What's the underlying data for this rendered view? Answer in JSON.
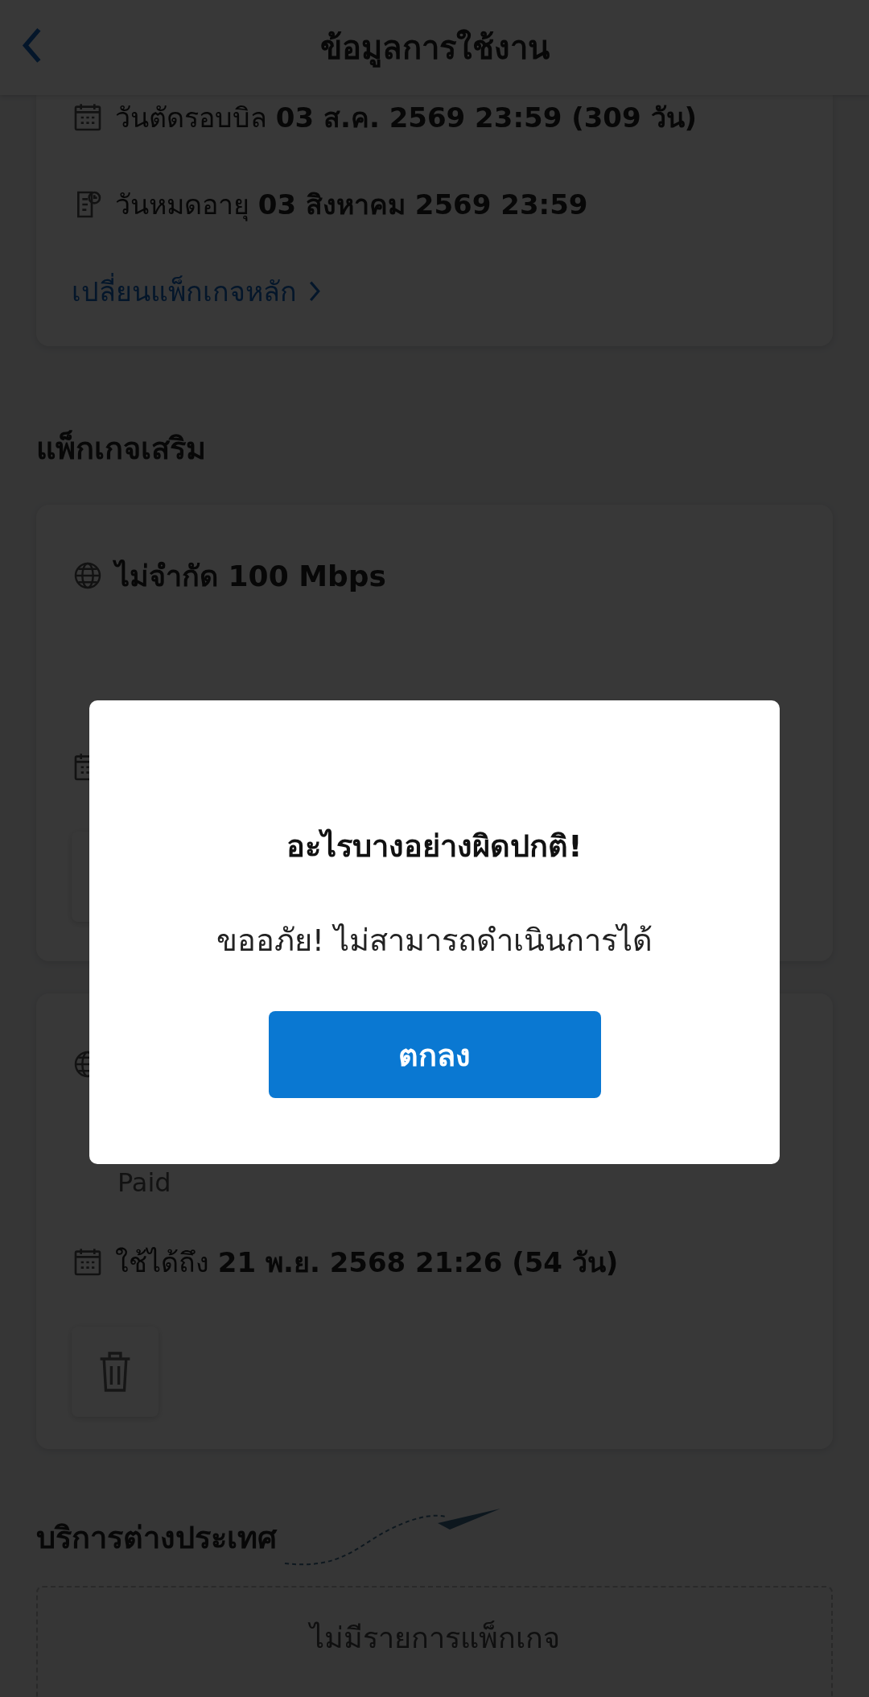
{
  "header": {
    "title": "ข้อมูลการใช้งาน"
  },
  "main_package": {
    "rows": [
      {
        "kind": "calendar",
        "text": "วันตัดรอบบิล **03 ส.ค. 2569 23:59 (309 วัน)**"
      },
      {
        "kind": "expiry",
        "text": "วันหมดอายุ **03 สิงหาคม 2569 23:59**"
      }
    ],
    "link": "เปลี่ยนแพ็กเกจหลัก"
  },
  "addons": {
    "title": "แพ็กเกจเสริม",
    "cards": [
      {
        "name": "ไม่จำกัด 100 Mbps"
      },
      {
        "status": "Paid",
        "valid_until": "ใช้ได้ถึง **21 พ.ย. 2568 21:26 (54 วัน)**"
      }
    ]
  },
  "international": {
    "title": "บริการต่างประเทศ",
    "empty": "ไม่มีรายการแพ็กเกจ"
  },
  "dialog": {
    "title": "อะไรบางอย่างผิดปกติ!",
    "message": "ขออภัย! ไม่สามารถดำเนินการได้",
    "button": "ตกลง"
  }
}
